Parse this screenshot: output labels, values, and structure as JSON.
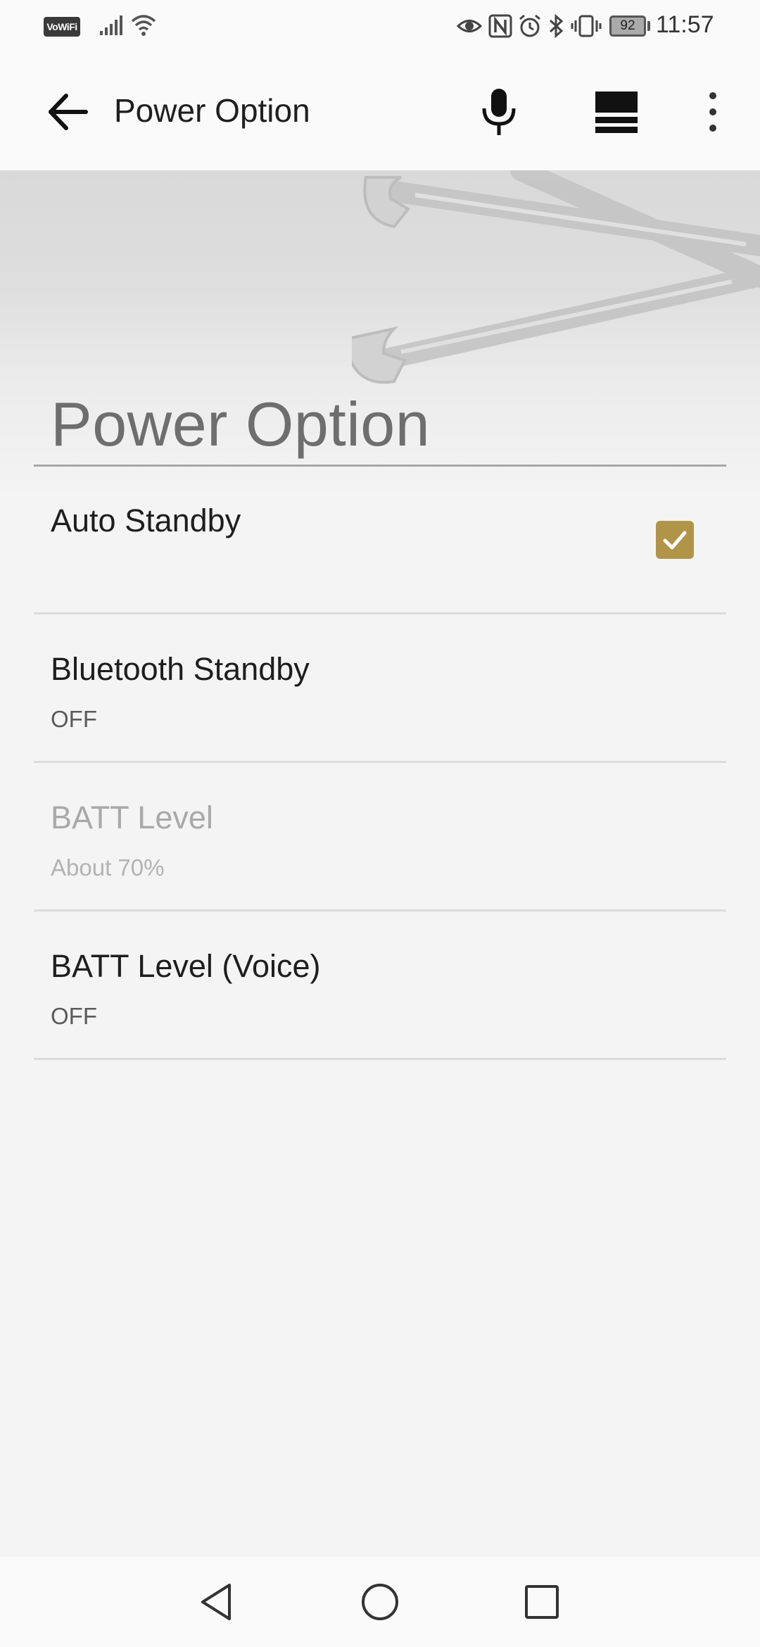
{
  "status_bar": {
    "vowifi_label": "VoWiFi",
    "battery_level": "92",
    "time": "11:57",
    "icons": [
      "signal-icon",
      "wifi-icon",
      "eye-comfort-icon",
      "nfc-icon",
      "alarm-icon",
      "bluetooth-icon",
      "vibrate-icon",
      "battery-icon"
    ]
  },
  "app_bar": {
    "title": "Power Option",
    "icons": [
      "back-arrow-icon",
      "microphone-icon",
      "layout-icon",
      "more-vert-icon"
    ]
  },
  "section": {
    "title": "Power Option"
  },
  "settings": [
    {
      "title": "Auto Standby",
      "subtitle": "",
      "checked": true,
      "enabled": true
    },
    {
      "title": "Bluetooth Standby",
      "subtitle": "OFF",
      "enabled": true
    },
    {
      "title": "BATT Level",
      "subtitle": "About 70%",
      "enabled": false
    },
    {
      "title": "BATT Level (Voice)",
      "subtitle": "OFF",
      "enabled": true
    }
  ],
  "nav_bar": {
    "icons": [
      "nav-back-icon",
      "nav-home-icon",
      "nav-recents-icon"
    ]
  },
  "colors": {
    "accent": "#b09548",
    "background": "#f4f4f4",
    "bar": "#fafafa"
  }
}
